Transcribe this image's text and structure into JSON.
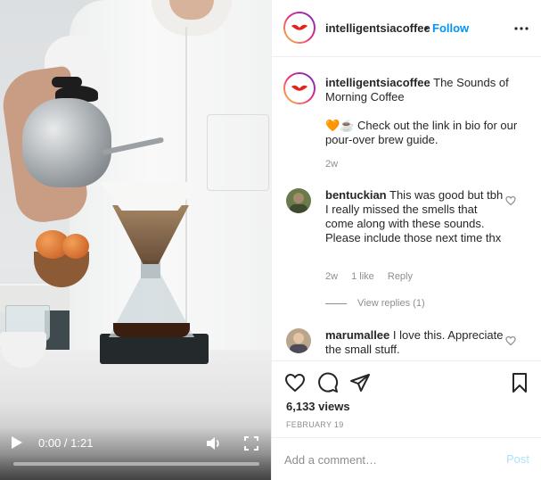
{
  "video": {
    "time_display": "0:00 / 1:21",
    "progress": 0.0,
    "icons": {
      "play": "play-icon",
      "volume": "volume-icon",
      "fullscreen": "fullscreen-icon"
    }
  },
  "post": {
    "username": "intelligentsiacoffee",
    "follow_separator": "•",
    "follow_label": "Follow",
    "more_icon": "more-options-icon"
  },
  "caption": {
    "username": "intelligentsiacoffee",
    "text": "The Sounds of Morning Coffee",
    "emojis": "🧡☕",
    "line2": "Check out the link in bio for our pour-over brew guide.",
    "time": "2w"
  },
  "comments": [
    {
      "username": "bentuckian",
      "text": "This was good but tbh I really missed the smells that come along with these sounds. Please include those next time thx",
      "time": "2w",
      "likes": "1 like",
      "reply": "Reply",
      "view_replies": "View replies (1)"
    },
    {
      "username": "marumallee",
      "text": "I love this. Appreciate the small stuff."
    }
  ],
  "actions": {
    "icons": [
      "heart-icon",
      "comment-icon",
      "share-icon",
      "bookmark-icon"
    ],
    "views": "6,133 views",
    "date": "FEBRUARY 19"
  },
  "add_comment": {
    "placeholder": "Add a comment…",
    "post_label": "Post"
  },
  "colors": {
    "link_blue": "#0095f6",
    "post_disabled": "#b2dffc",
    "muted_text": "#8e8e8e",
    "border": "#efefef",
    "brand_red": "#e2231a"
  }
}
